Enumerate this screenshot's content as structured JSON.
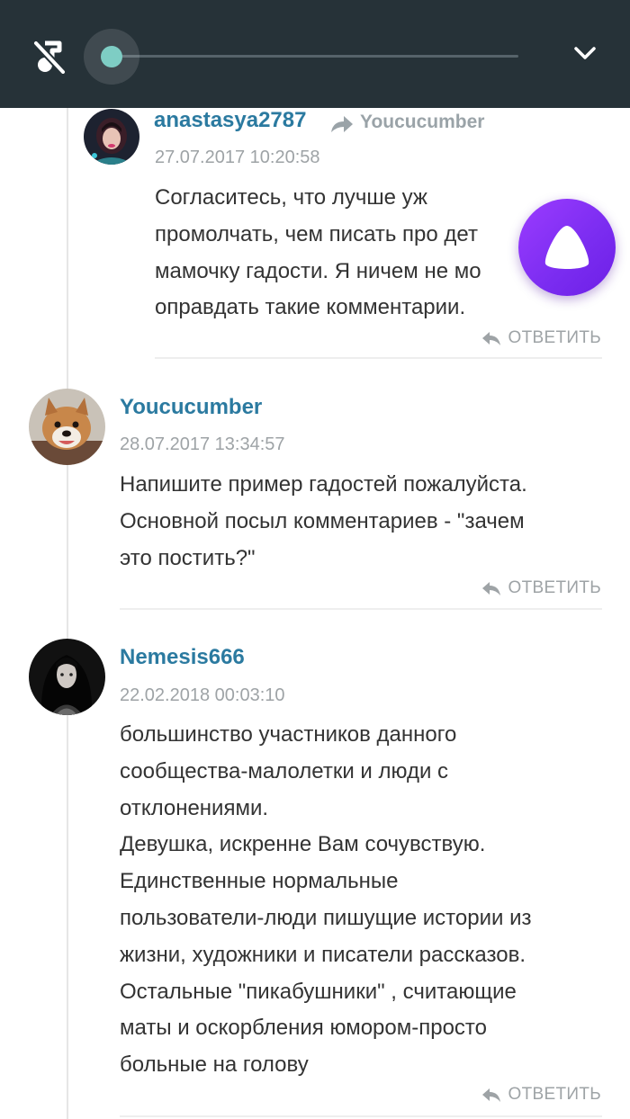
{
  "player": {
    "progress": 0,
    "icons": {
      "mute": "music-off-icon",
      "collapse": "chevron-down-icon"
    },
    "colors": {
      "bar": "#263238",
      "thumb": "#7ecdc4"
    }
  },
  "comments": [
    {
      "username": "anastasya2787",
      "reply_to": "Youcucumber",
      "timestamp": "27.07.2017 10:20:58",
      "text": "Согласитесь, что лучше уж\nпромолчать, чем писать про дет\nмамочку гадости. Я ничем не мо\nоправдать такие комментарии.",
      "reply_label": "ОТВЕТИТЬ"
    },
    {
      "username": "Youcucumber",
      "timestamp": "28.07.2017 13:34:57",
      "text": "Напишите пример гадостей пожалуйста.\nОсновной посыл комментариев - \"зачем\nэто постить?\"",
      "reply_label": "ОТВЕТИТЬ"
    },
    {
      "username": "Nemesis666",
      "timestamp": "22.02.2018 00:03:10",
      "text": "большинство участников данного\nсообщества-малолетки и люди с\nотклонениями.\nДевушка, искренне Вам сочувствую.\nЕдинственные нормальные\nпользователи-люди пишущие истории из\nжизни, художники и писатели рассказов.\nОстальные \"пикабушники\" , считающие\nматы и оскорбления юмором-просто\nбольные на голову",
      "reply_label": "ОТВЕТИТЬ"
    }
  ],
  "colors": {
    "username": "#2b7aa0",
    "muted": "#9ea3a6",
    "assistant": "#7a2cf0"
  }
}
